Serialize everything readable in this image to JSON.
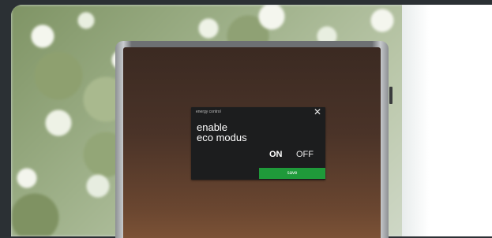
{
  "dialog": {
    "title": "energy control",
    "close_symbol": "✕",
    "heading_line1": "enable",
    "heading_line2": "eco modus",
    "on_label": "ON",
    "off_label": "OFF",
    "save_label": "save"
  },
  "icons": {
    "close": "close-icon"
  },
  "colors": {
    "dialog_background": "#1c1d1e",
    "save_button": "#1f9a3a",
    "device_screen": "#4a3328"
  }
}
